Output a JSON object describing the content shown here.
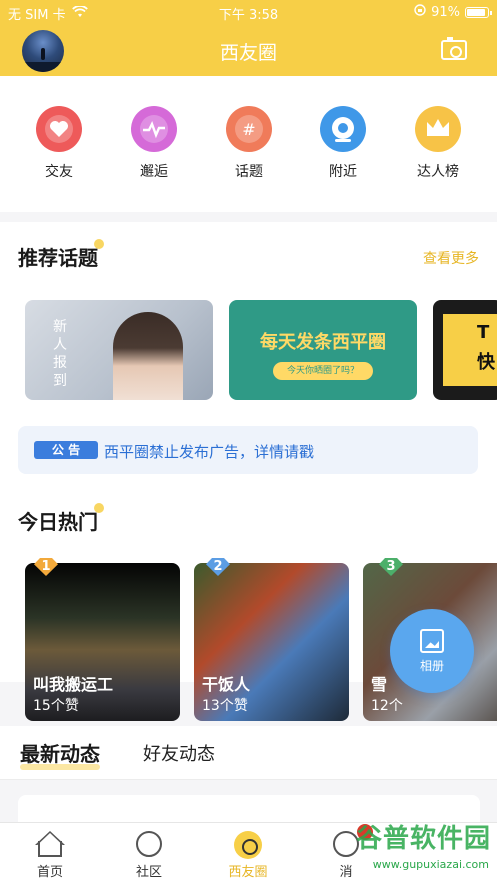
{
  "status": {
    "carrier": "无 SIM 卡",
    "time": "下午 3:58",
    "battery": "91%"
  },
  "header": {
    "title": "西友圈"
  },
  "categories": [
    {
      "label": "交友",
      "color": "#ee5a5a",
      "icon": "heart-icon"
    },
    {
      "label": "邂逅",
      "color": "#d56ad8",
      "icon": "heartbeat-icon"
    },
    {
      "label": "话题",
      "color": "#f07b5a",
      "icon": "hashtag-icon"
    },
    {
      "label": "附近",
      "color": "#3f98e8",
      "icon": "location-icon"
    },
    {
      "label": "达人榜",
      "color": "#f7c347",
      "icon": "crown-icon"
    }
  ],
  "topics": {
    "title": "推荐话题",
    "more": "查看更多",
    "card1_text": "新人报到",
    "card2_text": "每天发条西平圈",
    "card2_sub": "今天你晒圈了吗？",
    "card3_text1": "T",
    "card3_text2": "快"
  },
  "notice": {
    "tag": "公 告",
    "text": "西平圈禁止发布广告，详情请戳"
  },
  "hot": {
    "title": "今日热门",
    "items": [
      {
        "rank": "1",
        "name": "叫我搬运工",
        "likes": "15个赞",
        "badge_color": "#f2a93b"
      },
      {
        "rank": "2",
        "name": "干饭人",
        "likes": "13个赞",
        "badge_color": "#5b9de4"
      },
      {
        "rank": "3",
        "name": "雪",
        "likes": "12个",
        "badge_color": "#4caf6a"
      }
    ]
  },
  "fab": {
    "label": "相册"
  },
  "feed_tabs": {
    "active": "最新动态",
    "other": "好友动态"
  },
  "nav": [
    {
      "label": "首页"
    },
    {
      "label": "社区"
    },
    {
      "label": "西友圈"
    },
    {
      "label": "消"
    }
  ],
  "watermark": {
    "text": "谷普软件园",
    "url": "www.gupuxiazai.com"
  }
}
